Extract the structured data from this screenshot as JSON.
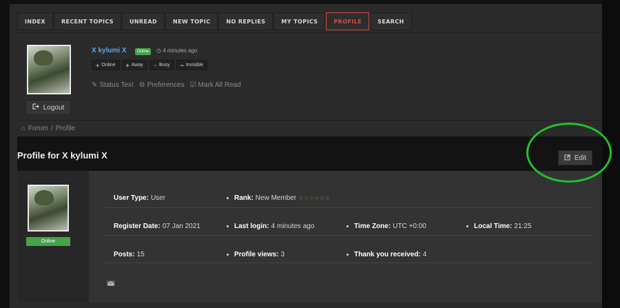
{
  "nav": {
    "tabs": [
      {
        "label": "INDEX"
      },
      {
        "label": "RECENT TOPICS"
      },
      {
        "label": "UNREAD"
      },
      {
        "label": "NEW TOPIC"
      },
      {
        "label": "NO REPLIES"
      },
      {
        "label": "MY TOPICS"
      },
      {
        "label": "PROFILE",
        "active": true
      },
      {
        "label": "SEARCH"
      }
    ]
  },
  "user_panel": {
    "username": "X kylumi X",
    "status_badge": "Online",
    "time_ago": "4 minutes ago",
    "status_buttons": [
      {
        "symbol": "+",
        "label": "Online",
        "color": "#7fd14d"
      },
      {
        "symbol": "+",
        "label": "Away",
        "color": "#f0c419"
      },
      {
        "symbol": "−",
        "label": "Busy",
        "color": "#e0453c"
      },
      {
        "symbol": "−",
        "label": "Invisible",
        "color": "#d0d0d0"
      }
    ],
    "links": {
      "status_text": "Status Text",
      "preferences": "Preferences",
      "mark_all_read": "Mark All Read"
    },
    "logout_label": "Logout"
  },
  "breadcrumb": {
    "forum": "Forum",
    "separator": "/",
    "profile": "Profile"
  },
  "profile": {
    "title": "Profile for X kylumi X",
    "edit_label": "Edit",
    "online_label": "Online",
    "rows": [
      [
        {
          "label": "User Type:",
          "value": "User"
        },
        {
          "label": "Rank:",
          "value": "New Member",
          "stars": "☆☆☆☆☆☆"
        }
      ],
      [
        {
          "label": "Register Date:",
          "value": "07 Jan 2021"
        },
        {
          "label": "Last login:",
          "value": "4 minutes ago"
        },
        {
          "label": "Time Zone:",
          "value": "UTC +0:00"
        },
        {
          "label": "Local Time:",
          "value": "21:25"
        }
      ],
      [
        {
          "label": "Posts:",
          "value": "15"
        },
        {
          "label": "Profile views:",
          "value": "3"
        },
        {
          "label": "Thank you received:",
          "value": "4"
        }
      ]
    ]
  },
  "colors": {
    "accent_red": "#e0453c",
    "link_blue": "#5ea6e6",
    "online_green": "#45a34a",
    "highlight_ring": "#22c12a"
  }
}
